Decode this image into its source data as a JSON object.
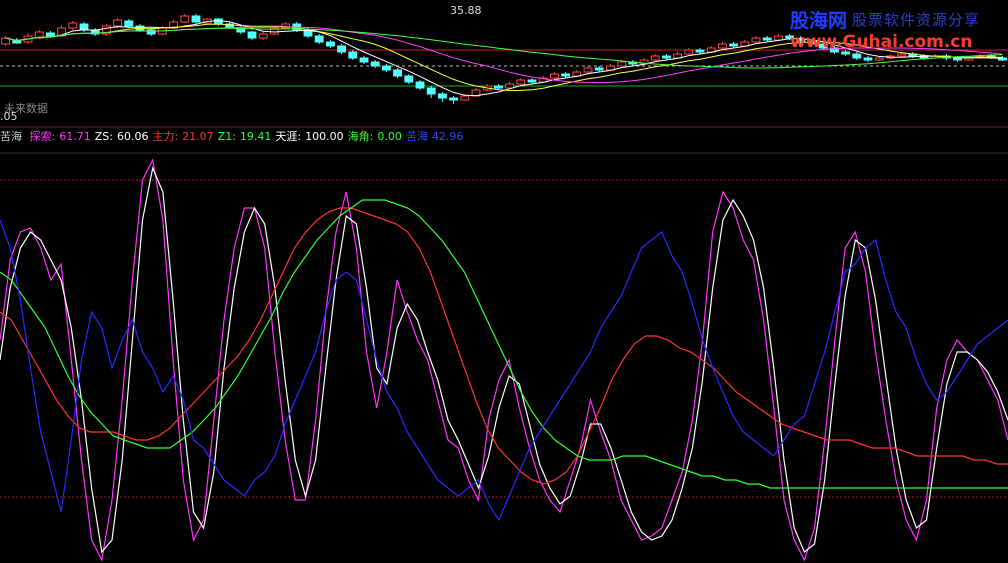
{
  "price_panel": {
    "high_label": "35.88",
    "low_label": ".05",
    "overlay_text": "未来数据"
  },
  "indicator_header": {
    "name": "苦海",
    "fields": [
      {
        "label": "探索:",
        "value": "61.71",
        "color": "#ff33ff"
      },
      {
        "label": "ZS:",
        "value": "60.06",
        "color": "#ffffff"
      },
      {
        "label": "主力:",
        "value": "21.07",
        "color": "#ff3333"
      },
      {
        "label": "Z1:",
        "value": "19.41",
        "color": "#33ff33"
      },
      {
        "label": "天涯:",
        "value": "100.00",
        "color": "#ffffff"
      },
      {
        "label": "海角:",
        "value": "0.00",
        "color": "#33ff33"
      },
      {
        "label": "苦海",
        "value": "42.96",
        "color": "#3344ff"
      }
    ]
  },
  "watermark": {
    "brand": "股海网",
    "tagline": "股票软件资源分享",
    "url": "www.Guhai.com.cn"
  },
  "chart_data": [
    {
      "type": "candlestick",
      "panel": "price",
      "candles": [
        [
          74,
          80,
          72,
          82
        ],
        [
          78,
          75,
          74,
          80
        ],
        [
          76,
          82,
          74,
          85
        ],
        [
          80,
          86,
          79,
          88
        ],
        [
          85,
          82,
          80,
          87
        ],
        [
          82,
          90,
          81,
          93
        ],
        [
          90,
          95,
          88,
          97
        ],
        [
          94,
          88,
          86,
          96
        ],
        [
          88,
          84,
          82,
          90
        ],
        [
          84,
          92,
          82,
          94
        ],
        [
          92,
          98,
          90,
          100
        ],
        [
          97,
          92,
          90,
          99
        ],
        [
          92,
          88,
          86,
          94
        ],
        [
          88,
          84,
          82,
          90
        ],
        [
          84,
          90,
          83,
          92
        ],
        [
          90,
          96,
          89,
          98
        ],
        [
          96,
          102,
          95,
          104
        ],
        [
          102,
          96,
          94,
          104
        ],
        [
          95,
          99,
          94,
          100
        ],
        [
          99,
          94,
          92,
          100
        ],
        [
          94,
          90,
          89,
          96
        ],
        [
          90,
          86,
          84,
          92
        ],
        [
          86,
          80,
          78,
          87
        ],
        [
          80,
          84,
          78,
          86
        ],
        [
          84,
          90,
          83,
          92
        ],
        [
          90,
          94,
          89,
          96
        ],
        [
          94,
          88,
          86,
          96
        ],
        [
          88,
          82,
          80,
          90
        ],
        [
          82,
          76,
          74,
          84
        ],
        [
          76,
          72,
          70,
          78
        ],
        [
          72,
          66,
          64,
          74
        ],
        [
          66,
          60,
          58,
          68
        ],
        [
          60,
          56,
          54,
          62
        ],
        [
          56,
          52,
          50,
          58
        ],
        [
          52,
          48,
          46,
          54
        ],
        [
          48,
          42,
          40,
          50
        ],
        [
          42,
          36,
          34,
          44
        ],
        [
          36,
          30,
          28,
          38
        ],
        [
          30,
          24,
          20,
          32
        ],
        [
          24,
          20,
          16,
          26
        ],
        [
          20,
          18,
          14,
          22
        ],
        [
          18,
          22,
          17,
          24
        ],
        [
          22,
          28,
          21,
          30
        ],
        [
          28,
          32,
          27,
          34
        ],
        [
          32,
          30,
          28,
          34
        ],
        [
          30,
          34,
          29,
          36
        ],
        [
          34,
          38,
          33,
          40
        ],
        [
          38,
          36,
          34,
          40
        ],
        [
          36,
          40,
          35,
          42
        ],
        [
          40,
          44,
          39,
          46
        ],
        [
          44,
          42,
          40,
          46
        ],
        [
          42,
          46,
          41,
          48
        ],
        [
          46,
          50,
          45,
          52
        ],
        [
          50,
          48,
          46,
          52
        ],
        [
          48,
          52,
          47,
          54
        ],
        [
          52,
          56,
          51,
          58
        ],
        [
          56,
          54,
          52,
          58
        ],
        [
          54,
          58,
          53,
          60
        ],
        [
          58,
          62,
          57,
          64
        ],
        [
          62,
          60,
          58,
          64
        ],
        [
          60,
          64,
          59,
          66
        ],
        [
          64,
          68,
          63,
          70
        ],
        [
          68,
          66,
          64,
          70
        ],
        [
          66,
          70,
          65,
          72
        ],
        [
          70,
          74,
          69,
          76
        ],
        [
          74,
          72,
          70,
          76
        ],
        [
          72,
          76,
          71,
          78
        ],
        [
          76,
          80,
          75,
          82
        ],
        [
          80,
          78,
          76,
          82
        ],
        [
          78,
          82,
          77,
          84
        ],
        [
          82,
          80,
          78,
          84
        ],
        [
          80,
          76,
          74,
          82
        ],
        [
          76,
          74,
          72,
          78
        ],
        [
          74,
          70,
          68,
          76
        ],
        [
          70,
          66,
          64,
          72
        ],
        [
          66,
          64,
          62,
          68
        ],
        [
          64,
          60,
          58,
          66
        ],
        [
          60,
          58,
          56,
          62
        ],
        [
          58,
          60,
          57,
          62
        ],
        [
          60,
          62,
          59,
          64
        ],
        [
          62,
          64,
          61,
          66
        ],
        [
          64,
          62,
          60,
          66
        ],
        [
          62,
          60,
          58,
          64
        ],
        [
          60,
          62,
          59,
          64
        ],
        [
          62,
          60,
          58,
          64
        ],
        [
          60,
          58,
          56,
          62
        ],
        [
          58,
          60,
          57,
          62
        ],
        [
          60,
          62,
          59,
          64
        ],
        [
          62,
          60,
          59,
          64
        ],
        [
          60,
          58,
          57,
          62
        ]
      ]
    },
    {
      "type": "line",
      "panel": "indicator",
      "ylim": [
        0,
        100
      ],
      "x_count": 120,
      "series": [
        {
          "color": "#ff33ff",
          "values": [
            55,
            75,
            82,
            83,
            78,
            70,
            74,
            50,
            25,
            5,
            0,
            15,
            40,
            70,
            95,
            100,
            85,
            50,
            20,
            5,
            10,
            35,
            60,
            78,
            88,
            88,
            78,
            52,
            30,
            15,
            15,
            35,
            62,
            82,
            92,
            78,
            52,
            38,
            52,
            70,
            62,
            55,
            50,
            40,
            30,
            28,
            20,
            15,
            35,
            45,
            50,
            38,
            28,
            20,
            15,
            12,
            20,
            28,
            40,
            32,
            25,
            15,
            10,
            5,
            6,
            8,
            15,
            22,
            35,
            55,
            82,
            92,
            88,
            80,
            75,
            60,
            38,
            15,
            5,
            0,
            8,
            30,
            55,
            78,
            82,
            72,
            52,
            35,
            20,
            10,
            5,
            15,
            38,
            50,
            55,
            52,
            50,
            45,
            40,
            30
          ]
        },
        {
          "color": "#ffffff",
          "values": [
            50,
            68,
            78,
            82,
            80,
            75,
            70,
            58,
            40,
            18,
            2,
            5,
            25,
            55,
            85,
            98,
            92,
            65,
            35,
            12,
            8,
            22,
            48,
            68,
            82,
            88,
            84,
            68,
            45,
            25,
            16,
            25,
            48,
            70,
            86,
            84,
            68,
            48,
            44,
            58,
            64,
            60,
            52,
            45,
            35,
            30,
            24,
            18,
            26,
            38,
            46,
            44,
            34,
            24,
            18,
            14,
            16,
            24,
            34,
            34,
            28,
            20,
            12,
            7,
            5,
            6,
            10,
            18,
            28,
            45,
            68,
            85,
            90,
            86,
            80,
            68,
            48,
            25,
            8,
            2,
            4,
            20,
            44,
            66,
            80,
            78,
            65,
            46,
            28,
            15,
            8,
            10,
            28,
            44,
            52,
            52,
            50,
            47,
            42,
            35
          ]
        },
        {
          "color": "#ff3333",
          "values": [
            62,
            60,
            55,
            50,
            45,
            40,
            36,
            33,
            32,
            32,
            32,
            31,
            30,
            30,
            31,
            33,
            36,
            39,
            42,
            45,
            48,
            51,
            55,
            60,
            66,
            72,
            78,
            82,
            85,
            87,
            88,
            88,
            87,
            86,
            85,
            84,
            82,
            78,
            72,
            64,
            56,
            48,
            40,
            33,
            28,
            25,
            22,
            20,
            19,
            20,
            22,
            26,
            32,
            38,
            45,
            50,
            54,
            56,
            56,
            55,
            53,
            52,
            50,
            48,
            45,
            42,
            40,
            38,
            36,
            34,
            33,
            32,
            31,
            30,
            30,
            30,
            29,
            28,
            28,
            28,
            27,
            26,
            26,
            26,
            26,
            26,
            25,
            25,
            24,
            24
          ]
        },
        {
          "color": "#33ff33",
          "values": [
            72,
            70,
            66,
            62,
            58,
            52,
            46,
            41,
            37,
            34,
            31,
            30,
            29,
            28,
            28,
            28,
            30,
            32,
            35,
            38,
            42,
            46,
            51,
            56,
            61,
            67,
            72,
            76,
            80,
            83,
            86,
            88,
            90,
            90,
            90,
            89,
            88,
            86,
            83,
            80,
            76,
            72,
            66,
            60,
            54,
            48,
            42,
            37,
            33,
            30,
            28,
            26,
            25,
            25,
            25,
            26,
            26,
            26,
            25,
            24,
            23,
            22,
            21,
            21,
            20,
            20,
            19,
            19,
            18,
            18,
            18,
            18,
            18,
            18,
            18,
            18,
            18,
            18,
            18,
            18,
            18,
            18,
            18,
            18,
            18,
            18,
            18,
            18,
            18,
            18
          ]
        },
        {
          "color": "#2a2aff",
          "values": [
            85,
            78,
            65,
            48,
            32,
            22,
            12,
            30,
            50,
            62,
            58,
            48,
            55,
            60,
            52,
            48,
            42,
            46,
            40,
            30,
            28,
            24,
            20,
            18,
            16,
            20,
            22,
            26,
            34,
            40,
            46,
            52,
            62,
            70,
            72,
            70,
            60,
            50,
            42,
            38,
            32,
            28,
            24,
            20,
            18,
            16,
            18,
            20,
            14,
            10,
            16,
            22,
            28,
            32,
            36,
            40,
            44,
            48,
            52,
            58,
            62,
            66,
            72,
            78,
            80,
            82,
            76,
            72,
            64,
            55,
            48,
            42,
            36,
            32,
            30,
            28,
            26,
            30,
            34,
            36,
            44,
            52,
            62,
            72,
            74,
            78,
            80,
            70,
            62,
            58,
            50,
            44,
            40,
            42,
            46,
            50,
            54,
            56,
            58,
            60
          ]
        }
      ]
    }
  ]
}
